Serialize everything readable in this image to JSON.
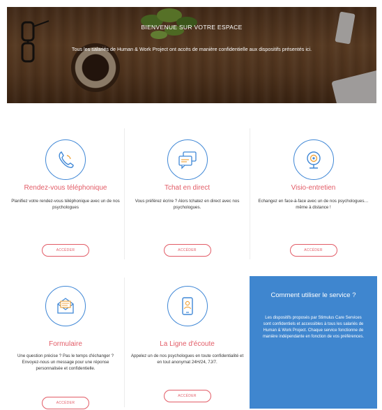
{
  "hero": {
    "title": "BIENVENUE SUR VOTRE ESPACE",
    "subtitle": "Tous les salariés de Human & Work Project ont accès de manière confidentielle aux dispositifs présentés ici."
  },
  "cards": [
    {
      "icon": "phone-icon",
      "title": "Rendez-vous téléphonique",
      "desc": "Planifiez votre rendez-vous téléphonique avec un de nos psychologues",
      "button": "ACCÉDER"
    },
    {
      "icon": "chat-icon",
      "title": "Tchat en direct",
      "desc": "Vous préférez écrire ? Alors tchatez en direct avec nos psychologues.",
      "button": "ACCÉDER"
    },
    {
      "icon": "webcam-icon",
      "title": "Visio-entretien",
      "desc": "Echangez en face-à-face avec un de nos psychologues… même à distance !",
      "button": "ACCÉDER"
    },
    {
      "icon": "mail-icon",
      "title": "Formulaire",
      "desc": "Une question précise ? Pas le temps d'échanger ? Envoyez-nous un message pour une réponse personnalisée et confidentielle.",
      "button": "ACCÉDER"
    },
    {
      "icon": "mobile-icon",
      "title": "La Ligne d'écoute",
      "desc": "Appelez un de nos psychologues en toute confidentialité et en tout anonymat 24H/24, 7J/7.",
      "button": "ACCÉDER"
    }
  ],
  "info": {
    "title": "Comment utiliser le service ?",
    "body": "Les dispositifs proposés par Stimulus Care Services sont confidentiels et accessibles à tous les salariés de Human & Work Project. Chaque service fonctionne de manière indépendante en fonction de vos préférences."
  },
  "colors": {
    "accent": "#e25b66",
    "blue": "#3f86cf"
  }
}
